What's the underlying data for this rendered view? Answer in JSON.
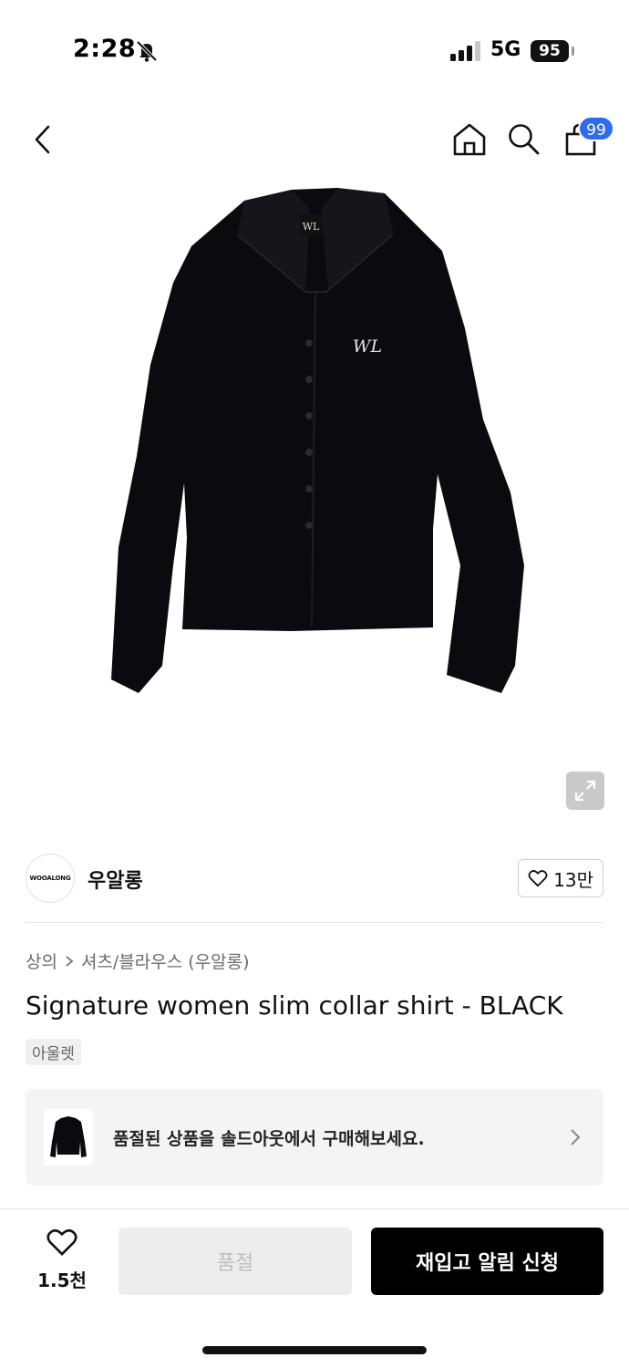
{
  "status_bar": {
    "time": "2:28",
    "network": "5G",
    "battery": "95"
  },
  "nav": {
    "cart_count": "99"
  },
  "brand": {
    "logo_text": "WOOALONG",
    "name": "우알롱",
    "likes": "13만"
  },
  "product": {
    "category": "상의",
    "subcategory": "셔츠/블라우스 (우알롱)",
    "title": "Signature women slim collar shirt - BLACK",
    "tag": "아울렛"
  },
  "banner": {
    "text": "품절된 상품을 솔드아웃에서 구매해보세요."
  },
  "bottom_bar": {
    "wish_count": "1.5천",
    "soldout_label": "품절",
    "restock_label": "재입고 알림 신청"
  },
  "icons": [
    "back-icon",
    "home-icon",
    "search-icon",
    "cart-icon",
    "expand-icon",
    "heart-icon",
    "chevron-right-icon",
    "bell-slash-icon"
  ]
}
